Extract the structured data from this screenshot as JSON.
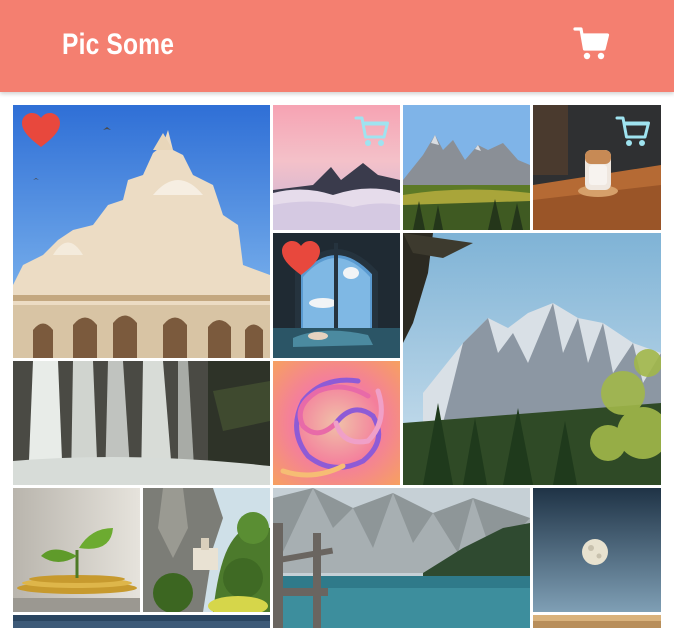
{
  "header": {
    "title": "Pic Some"
  },
  "icons": {
    "cart": "cart-icon",
    "heart": "heart-icon",
    "add_to_cart": "add-to-cart-icon"
  },
  "colors": {
    "header_bg": "#f47f70",
    "heart": "#e8483d",
    "cart_overlay": "#9fe3f0"
  },
  "gallery": [
    {
      "name": "palace-photo",
      "favorited": true,
      "in_cart": false
    },
    {
      "name": "pink-sky-mountain-photo",
      "favorited": false,
      "in_cart": true
    },
    {
      "name": "dolomites-meadow-photo",
      "favorited": false,
      "in_cart": false
    },
    {
      "name": "iced-coffee-photo",
      "favorited": false,
      "in_cart": true
    },
    {
      "name": "window-view-photo",
      "favorited": true,
      "in_cart": false
    },
    {
      "name": "snowy-mountain-forest-photo",
      "favorited": false,
      "in_cart": false
    },
    {
      "name": "waterfall-photo",
      "favorited": false,
      "in_cart": false
    },
    {
      "name": "colorful-swirl-photo",
      "favorited": false,
      "in_cart": false
    },
    {
      "name": "plant-coins-photo",
      "favorited": false,
      "in_cart": false
    },
    {
      "name": "cliff-village-photo",
      "favorited": false,
      "in_cart": false
    },
    {
      "name": "lake-dock-photo",
      "favorited": false,
      "in_cart": false
    },
    {
      "name": "moon-photo",
      "favorited": false,
      "in_cart": false
    }
  ]
}
